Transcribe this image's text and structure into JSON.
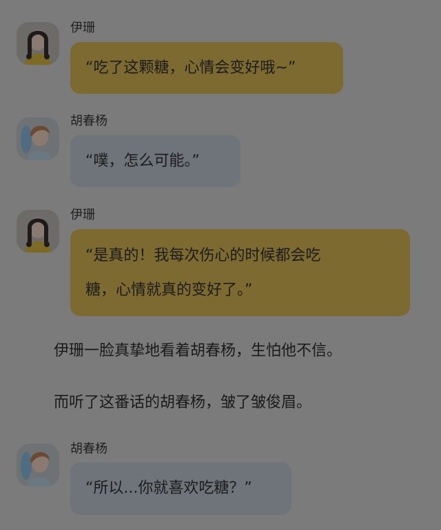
{
  "messages": [
    {
      "speaker": "伊珊",
      "avatar": "girl-avatar-icon",
      "text": "“吃了这颗糖，心情会变好哦~”",
      "color": "yellow"
    },
    {
      "speaker": "胡春杨",
      "avatar": "boy-avatar-icon",
      "text": "“噗，怎么可能。”",
      "color": "gray"
    },
    {
      "speaker": "伊珊",
      "avatar": "girl-avatar-icon",
      "text_line1": "“是真的！我每次伤心的时候都会吃",
      "text_line2": "糖，心情就真的变好了。”",
      "color": "yellow"
    },
    {
      "speaker": "胡春杨",
      "avatar": "boy-avatar-icon",
      "text": "“所以...你就喜欢吃糖？”",
      "color": "gray"
    }
  ],
  "narration": [
    "伊珊一脸真挚地看着胡春杨，生怕他不信。",
    "而听了这番话的胡春杨，皱了皱俊眉。"
  ],
  "colors": {
    "background": "#7b7b7b",
    "bubble_yellow": "#7d6a31",
    "bubble_gray": "#6f737a"
  }
}
